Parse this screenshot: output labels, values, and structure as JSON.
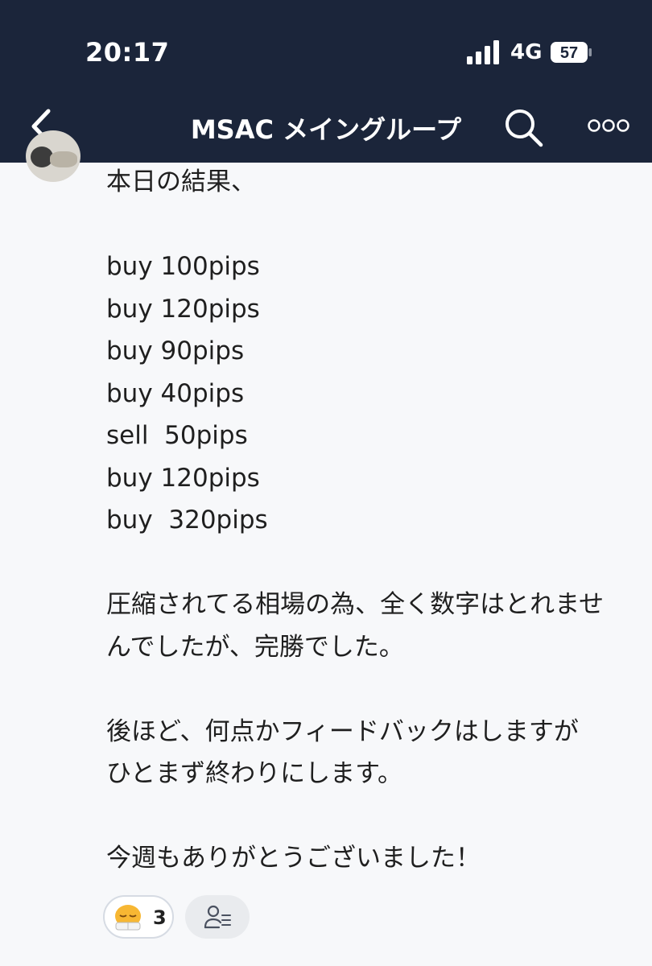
{
  "status_bar": {
    "time": "20:17",
    "network": "4G",
    "battery": "57"
  },
  "nav": {
    "title": "MSAC メイングループ",
    "icons": [
      "back-chevron-icon",
      "search-icon",
      "more-icon"
    ]
  },
  "message": {
    "lines": [
      "本日の結果、",
      "",
      "buy 100pips",
      "buy 120pips",
      "buy 90pips",
      "buy 40pips",
      "sell  50pips",
      "buy 120pips",
      "buy  320pips",
      "",
      "圧縮されてる相場の為、全く数字はとれませ",
      "んでしたが、完勝でした。",
      "",
      "後ほど、何点かフィードバックはしますが",
      "ひとまず終わりにします。",
      "",
      "今週もありがとうございました！"
    ]
  },
  "reactions": {
    "emoji_icon": "sleepy-face-emoji-icon",
    "count": "3",
    "seen_icon": "read-by-users-icon"
  },
  "colors": {
    "header_bg": "#1b253a",
    "page_bg": "#f7f8fa"
  }
}
